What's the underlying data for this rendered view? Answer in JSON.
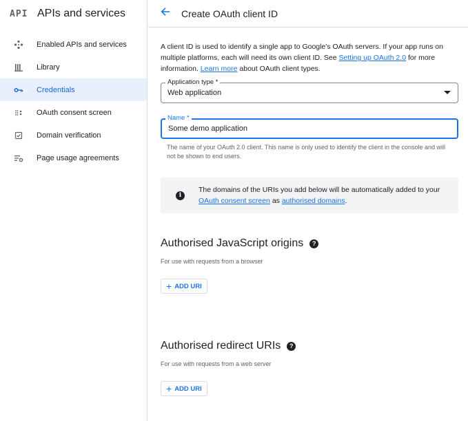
{
  "sidebar": {
    "logo": "API",
    "title": "APIs and services",
    "items": [
      {
        "label": "Enabled APIs and services",
        "icon": "enabled-apis-icon"
      },
      {
        "label": "Library",
        "icon": "library-icon"
      },
      {
        "label": "Credentials",
        "icon": "key-icon",
        "active": true
      },
      {
        "label": "OAuth consent screen",
        "icon": "consent-icon"
      },
      {
        "label": "Domain verification",
        "icon": "checkbox-icon"
      },
      {
        "label": "Page usage agreements",
        "icon": "settings-list-icon"
      }
    ]
  },
  "header": {
    "back_icon": "arrow-back-icon",
    "title": "Create OAuth client ID"
  },
  "intro": {
    "text_1": "A client ID is used to identify a single app to Google's OAuth servers. If your app runs on multiple platforms, each will need its own client ID. See ",
    "link_1": "Setting up OAuth 2.0",
    "text_2": " for more information. ",
    "link_2": "Learn more",
    "text_3": " about OAuth client types."
  },
  "form": {
    "app_type_label": "Application type *",
    "app_type_value": "Web application",
    "name_label": "Name *",
    "name_value": "Some demo application",
    "name_hint": "The name of your OAuth 2.0 client. This name is only used to identify the client in the console and will not be shown to end users."
  },
  "info": {
    "text_1": "The domains of the URIs you add below will be automatically added to your ",
    "link_1": "OAuth consent screen",
    "text_2": " as ",
    "link_2": "authorised domains",
    "text_3": "."
  },
  "js_origins": {
    "title": "Authorised JavaScript origins",
    "subtitle": "For use with requests from a browser",
    "button": "ADD URI"
  },
  "redirect_uris": {
    "title": "Authorised redirect URIs",
    "subtitle": "For use with requests from a web server",
    "button": "ADD URI"
  },
  "colors": {
    "accent": "#1a73e8",
    "active_bg": "#e8f0fe",
    "active_text": "#1967d2",
    "info_bg": "#f1f3f4"
  }
}
